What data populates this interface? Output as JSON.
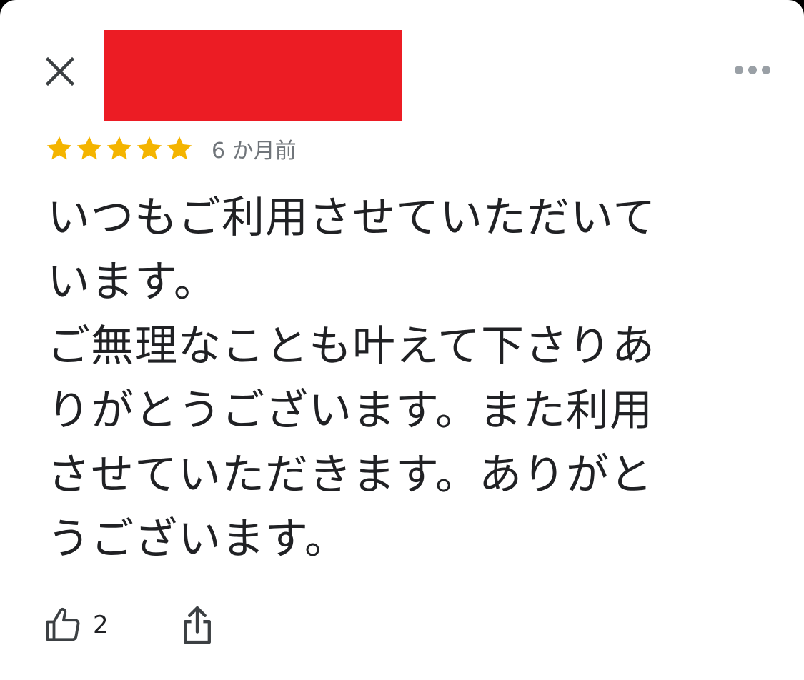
{
  "header": {
    "close_icon": "close-icon",
    "more_icon": "more-horizontal-icon",
    "redaction_color": "#ec1c24"
  },
  "review": {
    "rating": 5,
    "rating_max": 5,
    "star_color": "#f4b400",
    "time_ago": "6 か月前",
    "text": "いつもご利用させていただいて\nいます。\nご無理なことも叶えて下さりあ\nりがとうございます。また利用\nさせていただきます。ありがと\nうございます。"
  },
  "actions": {
    "like_icon": "thumbs-up-icon",
    "like_count": "2",
    "share_icon": "share-icon"
  }
}
